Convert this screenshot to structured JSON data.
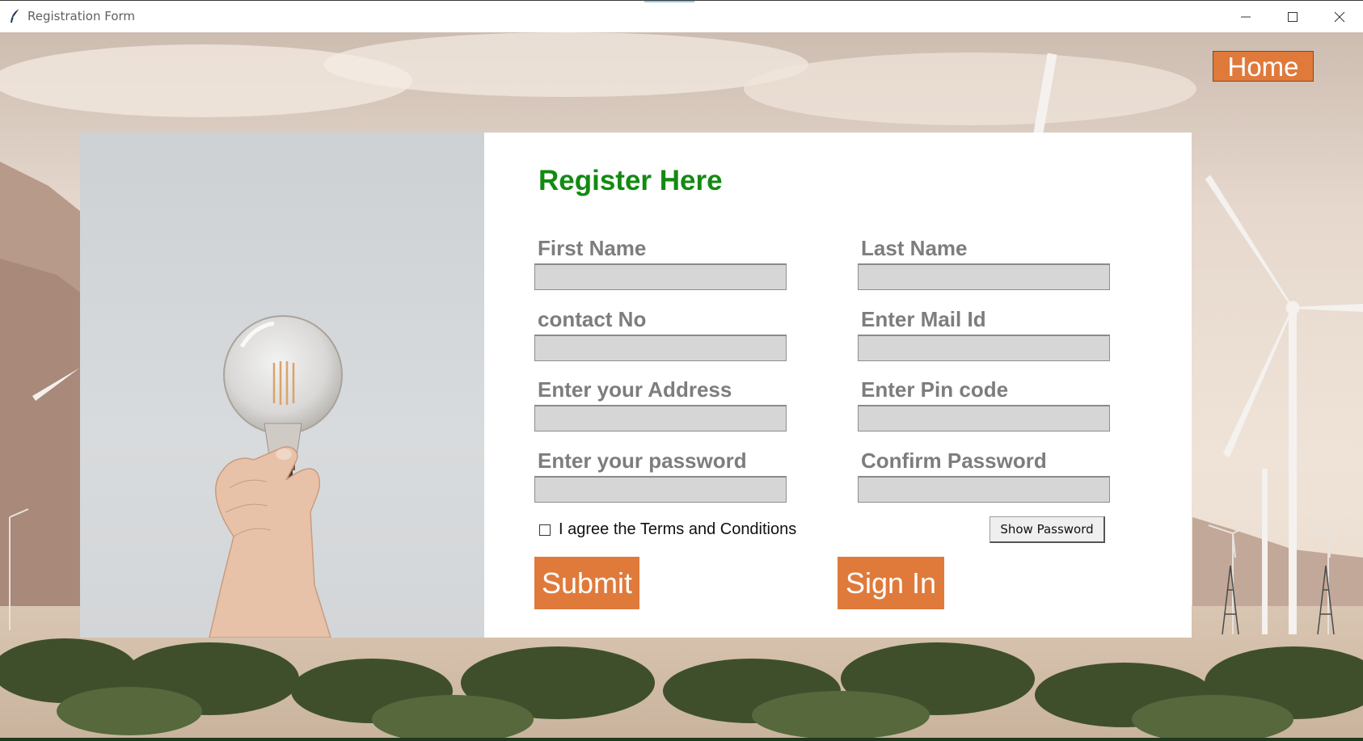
{
  "window": {
    "title": "Registration Form",
    "icon": "feather-icon",
    "controls": [
      "minimize-icon",
      "maximize-icon",
      "close-icon"
    ]
  },
  "nav": {
    "home_label": "Home"
  },
  "form": {
    "title": "Register Here",
    "fields": [
      {
        "label": "First Name",
        "value": ""
      },
      {
        "label": "Last Name",
        "value": ""
      },
      {
        "label": "contact No",
        "value": ""
      },
      {
        "label": "Enter Mail Id",
        "value": ""
      },
      {
        "label": "Enter your Address",
        "value": ""
      },
      {
        "label": "Enter Pin code",
        "value": ""
      },
      {
        "label": "Enter your password",
        "value": ""
      },
      {
        "label": "Confirm Password",
        "value": ""
      }
    ],
    "terms_label": "I agree the Terms and Conditions",
    "terms_checked": false,
    "show_password_label": "Show Password",
    "submit_label": "Submit",
    "signin_label": "Sign In"
  },
  "colors": {
    "accent_button": "#df7a3b",
    "title_green": "#138a12",
    "label_gray": "#7d7d7d",
    "input_bg": "#d6d6d6"
  }
}
